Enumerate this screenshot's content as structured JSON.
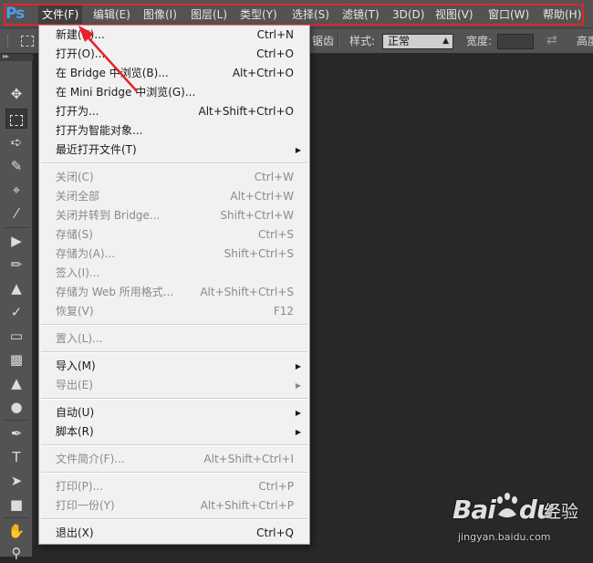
{
  "app": {
    "logo": "Ps",
    "logo_color": "#4aa0e8",
    "annotation_color": "#e8202a"
  },
  "menubar": {
    "items": [
      {
        "label": "文件(F)"
      },
      {
        "label": "编辑(E)"
      },
      {
        "label": "图像(I)"
      },
      {
        "label": "图层(L)"
      },
      {
        "label": "类型(Y)"
      },
      {
        "label": "选择(S)"
      },
      {
        "label": "滤镜(T)"
      },
      {
        "label": "3D(D)"
      },
      {
        "label": "视图(V)"
      },
      {
        "label": "窗口(W)"
      },
      {
        "label": "帮助(H)"
      }
    ],
    "active_index": 0
  },
  "optionsbar": {
    "partial_label": "锯齿",
    "style_label": "样式:",
    "style_value": "正常",
    "width_label": "宽度:",
    "height_label": "高度"
  },
  "tools": {
    "icons": [
      "move-icon",
      "rectangular-marquee-icon",
      "lasso-icon",
      "quick-selection-icon",
      "crop-icon",
      "eyedropper-icon",
      "healing-brush-icon",
      "brush-icon",
      "clone-stamp-icon",
      "history-brush-icon",
      "eraser-icon",
      "gradient-icon",
      "blur-icon",
      "dodge-icon",
      "pen-icon",
      "type-icon",
      "path-selection-icon",
      "rectangle-shape-icon",
      "hand-icon",
      "zoom-icon"
    ],
    "selected": "rectangular-marquee-icon"
  },
  "file_menu": {
    "groups": [
      [
        {
          "label": "新建(N)...",
          "shortcut": "Ctrl+N",
          "enabled": true
        },
        {
          "label": "打开(O)...",
          "shortcut": "Ctrl+O",
          "enabled": true
        },
        {
          "label": "在 Bridge 中浏览(B)...",
          "shortcut": "Alt+Ctrl+O",
          "enabled": true
        },
        {
          "label": "在 Mini Bridge 中浏览(G)...",
          "shortcut": "",
          "enabled": true
        },
        {
          "label": "打开为...",
          "shortcut": "Alt+Shift+Ctrl+O",
          "enabled": true
        },
        {
          "label": "打开为智能对象...",
          "shortcut": "",
          "enabled": true
        },
        {
          "label": "最近打开文件(T)",
          "shortcut": "",
          "enabled": true,
          "submenu": true
        }
      ],
      [
        {
          "label": "关闭(C)",
          "shortcut": "Ctrl+W",
          "enabled": false
        },
        {
          "label": "关闭全部",
          "shortcut": "Alt+Ctrl+W",
          "enabled": false
        },
        {
          "label": "关闭并转到 Bridge...",
          "shortcut": "Shift+Ctrl+W",
          "enabled": false
        },
        {
          "label": "存储(S)",
          "shortcut": "Ctrl+S",
          "enabled": false
        },
        {
          "label": "存储为(A)...",
          "shortcut": "Shift+Ctrl+S",
          "enabled": false
        },
        {
          "label": "签入(I)...",
          "shortcut": "",
          "enabled": false
        },
        {
          "label": "存储为 Web 所用格式...",
          "shortcut": "Alt+Shift+Ctrl+S",
          "enabled": false
        },
        {
          "label": "恢复(V)",
          "shortcut": "F12",
          "enabled": false
        }
      ],
      [
        {
          "label": "置入(L)...",
          "shortcut": "",
          "enabled": false
        }
      ],
      [
        {
          "label": "导入(M)",
          "shortcut": "",
          "enabled": true,
          "submenu": true
        },
        {
          "label": "导出(E)",
          "shortcut": "",
          "enabled": false,
          "submenu": true
        }
      ],
      [
        {
          "label": "自动(U)",
          "shortcut": "",
          "enabled": true,
          "submenu": true
        },
        {
          "label": "脚本(R)",
          "shortcut": "",
          "enabled": true,
          "submenu": true
        }
      ],
      [
        {
          "label": "文件简介(F)...",
          "shortcut": "Alt+Shift+Ctrl+I",
          "enabled": false
        }
      ],
      [
        {
          "label": "打印(P)...",
          "shortcut": "Ctrl+P",
          "enabled": false
        },
        {
          "label": "打印一份(Y)",
          "shortcut": "Alt+Shift+Ctrl+P",
          "enabled": false
        }
      ],
      [
        {
          "label": "退出(X)",
          "shortcut": "Ctrl+Q",
          "enabled": true
        }
      ]
    ]
  },
  "watermark": {
    "brand": "Bai",
    "brand_suffix": "du",
    "product": "经验",
    "url": "jingyan.baidu.com"
  }
}
